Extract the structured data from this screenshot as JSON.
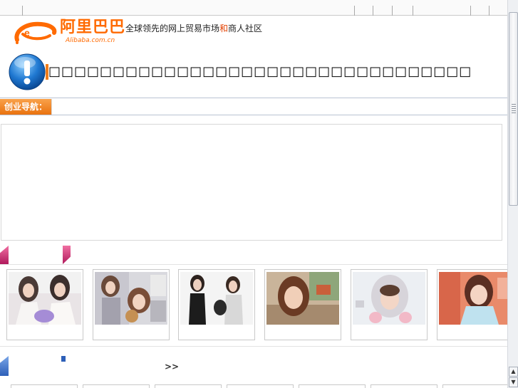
{
  "header": {
    "logo_cn": "阿里巴巴",
    "logo_en": "Alibaba.com.cn",
    "slogan_before": "全球领先的网上贸易市场",
    "slogan_highlight": "和",
    "slogan_after": "商人社区"
  },
  "warning": {
    "text": "□□□□□□□□□□□□□□□□□□□□□□□□□□□□□□□□□",
    "icon": "info-exclamation-icon"
  },
  "nav": {
    "button_label": "创业导航："
  },
  "section2": {
    "more_label": ">>"
  },
  "colors": {
    "brand_orange": "#ff6a00",
    "nav_orange": "#e9720f",
    "section1_pink": "#c0266a",
    "section2_blue": "#2d5fb8"
  }
}
